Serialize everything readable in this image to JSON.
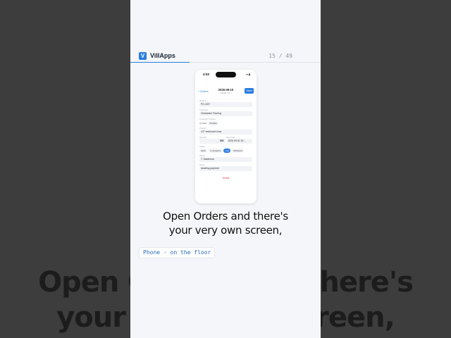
{
  "background_caption": {
    "line1": "Open Orders and there's",
    "line2": "your very own screen,"
  },
  "header": {
    "logo_letter": "V",
    "brand": "VillApps",
    "counter": "15 / 49",
    "progress": 0.31
  },
  "phone": {
    "time": "4:53",
    "status_icons": "▾ ▮",
    "nav": {
      "back": "‹ Orders",
      "title": "2026-09-10",
      "subtitle": "Details form",
      "save": "Save"
    },
    "fields": [
      {
        "label": "Order #",
        "value": "PO-2437"
      },
      {
        "label": "Customer",
        "value": "Clearwater Flooring"
      },
      {
        "label": "Customer Contact",
        "value": "Charles"
      },
      {
        "label": "Product",
        "value": "1/2\" reinforced hose"
      }
    ],
    "contact_prefix": "Contact",
    "quantity": {
      "label": "Quantity",
      "value": "500"
    },
    "due_date": {
      "label": "Due Date",
      "value": "2026-09-30 15:..."
    },
    "status": {
      "label": "Status",
      "options": [
        "Open",
        "In progress",
        "Late",
        "Delivered"
      ],
      "selected": 2
    },
    "owner": {
      "label": "Owner",
      "value": "T. Nakamura"
    },
    "notes": {
      "label": "Notes",
      "value": "Awaiting payment"
    },
    "delete": "Delete"
  },
  "caption": {
    "line1": "Open Orders and there's",
    "line2": "your very own screen,"
  },
  "tag": "Phone · on the floor",
  "colors": {
    "accent": "#2a7de1",
    "danger": "#e0433b",
    "page": "#f4f6f9",
    "backdrop": "#3d3d3d"
  }
}
